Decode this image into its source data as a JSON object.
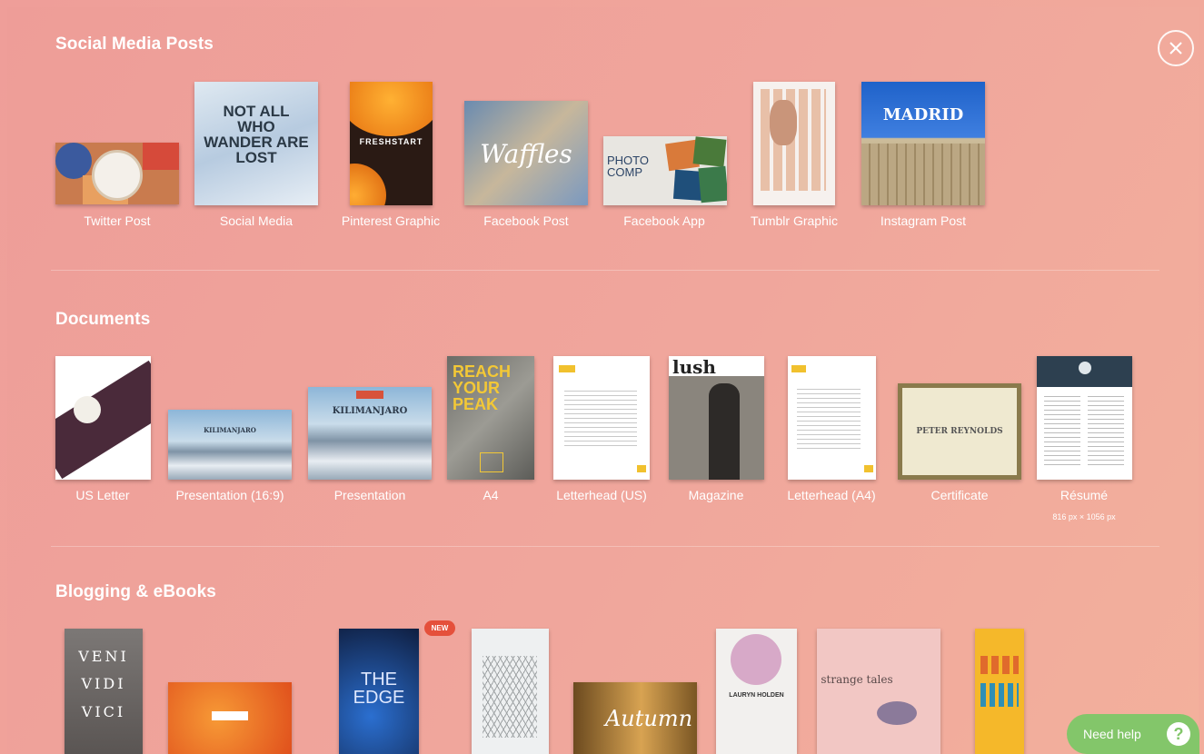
{
  "close_icon": "close-icon",
  "sections": {
    "social": {
      "title": "Social Media Posts",
      "items": [
        {
          "label": "Twitter Post"
        },
        {
          "label": "Social Media"
        },
        {
          "label": "Pinterest Graphic"
        },
        {
          "label": "Facebook Post"
        },
        {
          "label": "Facebook App"
        },
        {
          "label": "Tumblr Graphic"
        },
        {
          "label": "Instagram Post"
        }
      ]
    },
    "documents": {
      "title": "Documents",
      "items": [
        {
          "label": "US Letter"
        },
        {
          "label": "Presentation (16:9)"
        },
        {
          "label": "Presentation"
        },
        {
          "label": "A4"
        },
        {
          "label": "Letterhead (US)"
        },
        {
          "label": "Magazine"
        },
        {
          "label": "Letterhead (A4)"
        },
        {
          "label": "Certificate"
        },
        {
          "label": "Résumé",
          "sublabel": "816 px × 1056 px"
        }
      ]
    },
    "blogging": {
      "title": "Blogging & eBooks",
      "new_badge": "NEW"
    }
  },
  "thumb_text": {
    "social_media_lines": "NOT ALL WHO WANDER ARE LOST",
    "pinterest": "FRESHSTART",
    "facebook_post": "Waffles",
    "facebook_app": "PHOTO COMP",
    "instagram": "MADRID",
    "presentation_mountain": "KILIMANJARO",
    "a4": "REACH YOUR PEAK",
    "magazine": "lush",
    "certificate": "PETER REYNOLDS",
    "veni": "VENI VIDI VICI",
    "the_edge": "THE EDGE",
    "autumn": "Autumn",
    "strange_tales": "strange tales",
    "lauryn": "LAURYN HOLDEN"
  },
  "help": {
    "label": "Need help",
    "icon": "question-icon"
  },
  "colors": {
    "background": "#f0a59b",
    "help_green": "#83c66a",
    "badge_red": "#e5503b"
  }
}
